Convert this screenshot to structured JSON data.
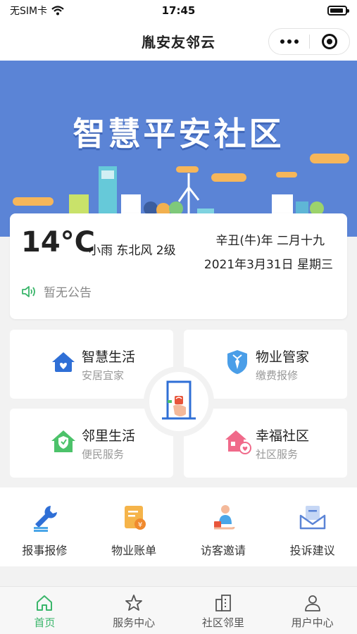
{
  "status_bar": {
    "carrier": "无SIM卡",
    "time": "17:45"
  },
  "nav": {
    "title": "胤安友邻云"
  },
  "banner": {
    "title": "智慧平安社区"
  },
  "weather": {
    "temperature": "14°C",
    "description": "小雨 东北风 2级",
    "lunar_date": "辛丑(牛)年 二月十九",
    "date": "2021年3月31日 星期三",
    "notice": "暂无公告"
  },
  "features": [
    {
      "title": "智慧生活",
      "subtitle": "安居宜家",
      "icon": "smart-home-icon"
    },
    {
      "title": "物业管家",
      "subtitle": "缴费报修",
      "icon": "butler-shield-icon"
    },
    {
      "title": "邻里生活",
      "subtitle": "便民服务",
      "icon": "neighbor-home-icon"
    },
    {
      "title": "幸福社区",
      "subtitle": "社区服务",
      "icon": "community-house-icon"
    }
  ],
  "quick_services": [
    {
      "label": "报事报修",
      "icon": "wrench-icon"
    },
    {
      "label": "物业账单",
      "icon": "bill-icon"
    },
    {
      "label": "访客邀请",
      "icon": "visitor-icon"
    },
    {
      "label": "投诉建议",
      "icon": "complaint-icon"
    }
  ],
  "tabs": [
    {
      "label": "首页",
      "icon": "home-icon",
      "active": true
    },
    {
      "label": "服务中心",
      "icon": "star-icon",
      "active": false
    },
    {
      "label": "社区邻里",
      "icon": "building-icon",
      "active": false
    },
    {
      "label": "用户中心",
      "icon": "user-icon",
      "active": false
    }
  ],
  "colors": {
    "banner_blue": "#5b84d6",
    "accent_green": "#3bb66b",
    "cloud_orange": "#f6b65a"
  }
}
